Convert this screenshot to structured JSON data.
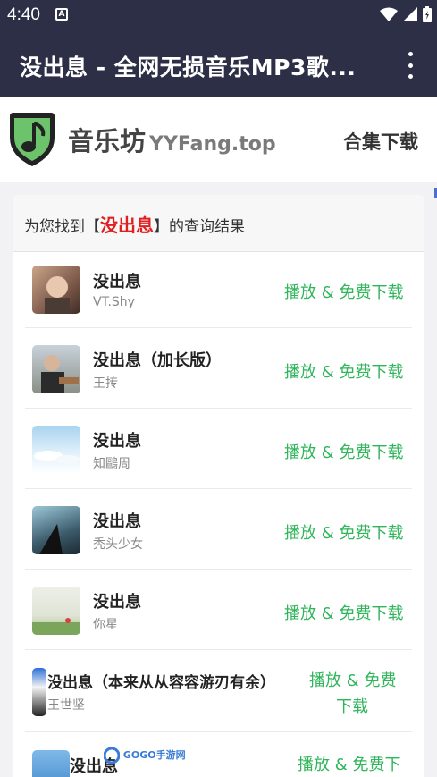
{
  "status": {
    "time": "4:40",
    "notif": "A"
  },
  "appbar": {
    "title": "没出息 - 全网无损音乐MP3歌..."
  },
  "header": {
    "logo_name": "音乐坊",
    "logo_domain": "YYFang.top",
    "link": "合集下载"
  },
  "results": {
    "prefix": "为您找到【",
    "keyword": "没出息",
    "suffix": "】的查询结果"
  },
  "songs": [
    {
      "title": "没出息",
      "artist": "VT.Shy",
      "action": "播放 & 免费下载"
    },
    {
      "title": "没出息（加长版）",
      "artist": "王抟",
      "action": "播放 & 免费下载"
    },
    {
      "title": "没出息",
      "artist": "知鷗周",
      "action": "播放 & 免费下载"
    },
    {
      "title": "没出息",
      "artist": "秃头少女",
      "action": "播放 & 免费下载"
    },
    {
      "title": "没出息",
      "artist": "你星",
      "action": "播放 & 免费下载"
    },
    {
      "title": "没出息（本来从从容容游刃有余）",
      "artist": "王世坚",
      "action_line1": "播放 & 免费",
      "action_line2": "下载"
    },
    {
      "title": "没出息",
      "action": "播放 & 免费下"
    }
  ],
  "watermark": "GOGO手游网",
  "colors": {
    "bar": "#2c2f45",
    "accent_green": "#2fb55a",
    "keyword_red": "#e02020"
  }
}
